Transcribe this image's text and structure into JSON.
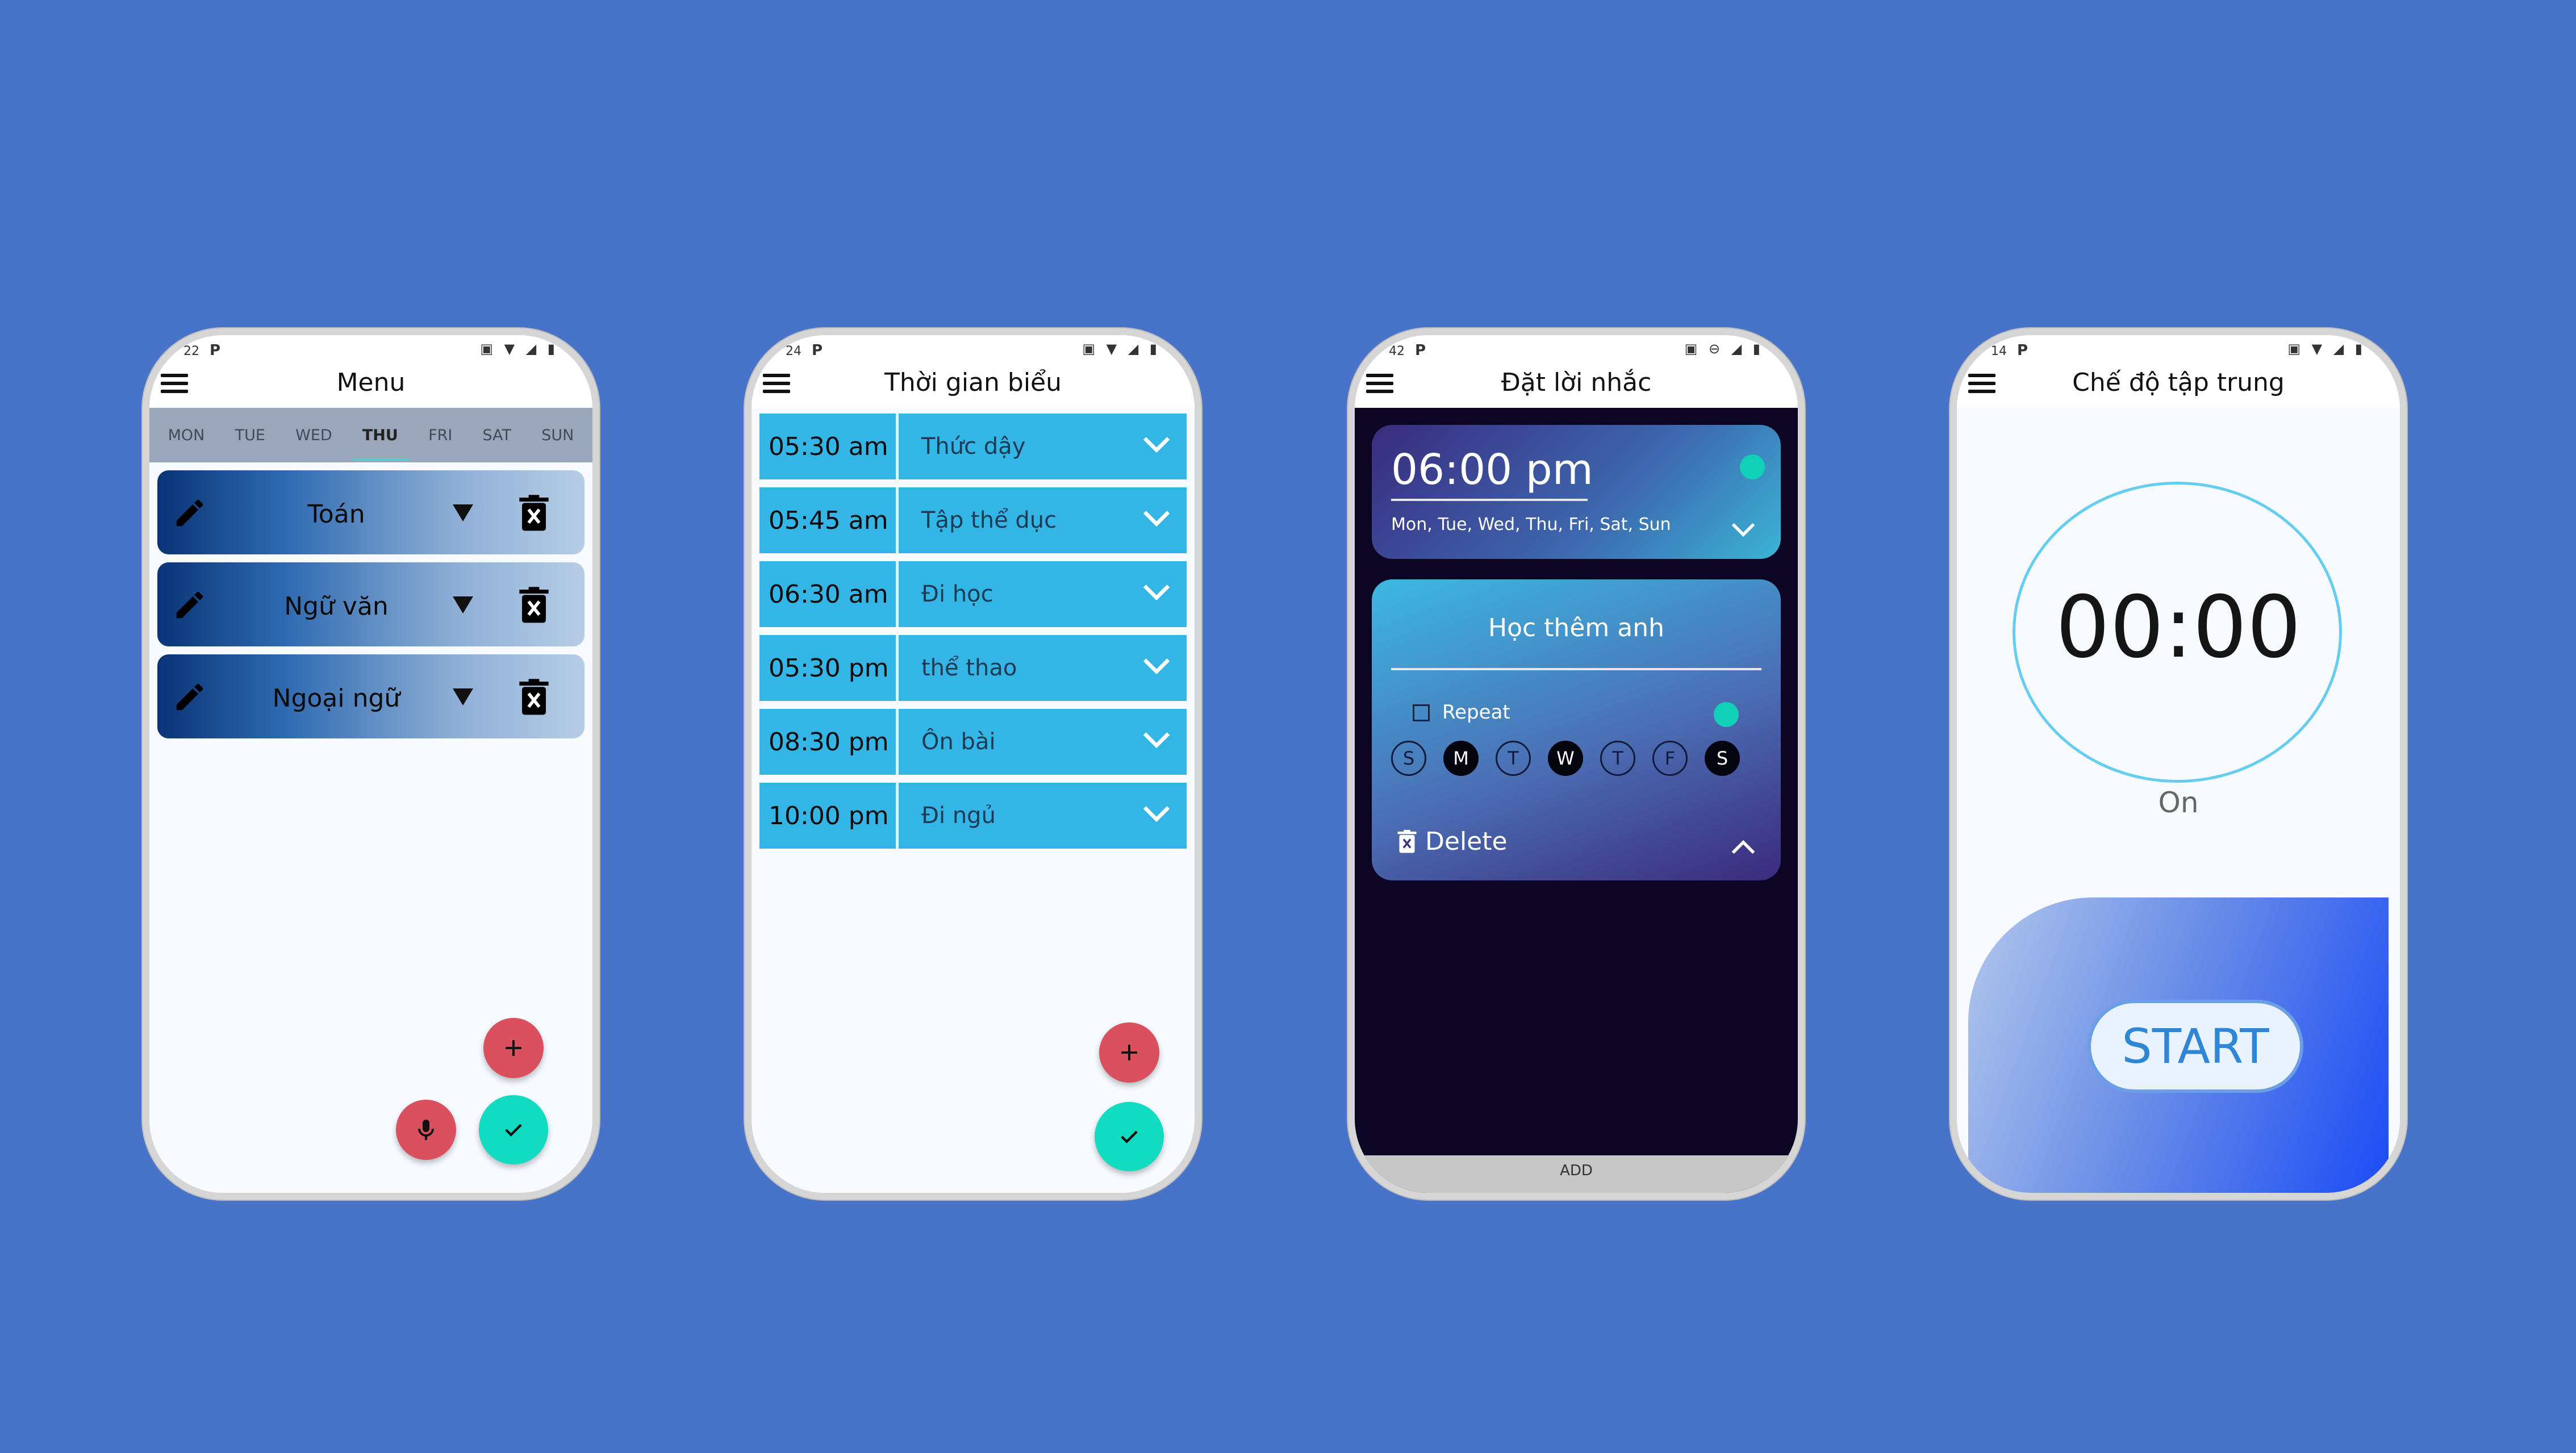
{
  "phone1": {
    "status_time": "22",
    "status_carrier": "P",
    "title": "Menu",
    "days": [
      "MON",
      "TUE",
      "WED",
      "THU",
      "FRI",
      "SAT",
      "SUN"
    ],
    "active_day": "THU",
    "subjects": [
      "Toán",
      "Ngữ văn",
      "Ngoại ngữ"
    ]
  },
  "phone2": {
    "status_time": "24",
    "status_carrier": "P",
    "title": "Thời gian biểu",
    "schedule": [
      {
        "time": "05:30 am",
        "activity": "Thức dậy"
      },
      {
        "time": "05:45 am",
        "activity": "Tập thể dục"
      },
      {
        "time": "06:30 am",
        "activity": "Đi học"
      },
      {
        "time": "05:30 pm",
        "activity": "thể thao"
      },
      {
        "time": "08:30 pm",
        "activity": "Ôn bài"
      },
      {
        "time": "10:00 pm",
        "activity": "Đi ngủ"
      }
    ]
  },
  "phone3": {
    "status_time": "42",
    "status_carrier": "P",
    "title": "Đặt lời nhắc",
    "alarm_time": "06:00 pm",
    "alarm_days": "Mon, Tue, Wed, Thu, Fri, Sat, Sun",
    "label": "Học thêm anh",
    "repeat_label": "Repeat",
    "week_days": [
      "S",
      "M",
      "T",
      "W",
      "T",
      "F",
      "S"
    ],
    "delete_label": "Delete",
    "add_label": "ADD"
  },
  "phone4": {
    "status_time": "14",
    "status_carrier": "P",
    "title": "Chế độ tập trung",
    "timer": "00:00",
    "state": "On",
    "start_label": "START"
  },
  "colors": {
    "background": "#4774c8",
    "schedule_row": "#33b6e6",
    "fab_red": "#d9505e",
    "fab_teal": "#11dbc0",
    "dark_bg": "#0c0523"
  }
}
